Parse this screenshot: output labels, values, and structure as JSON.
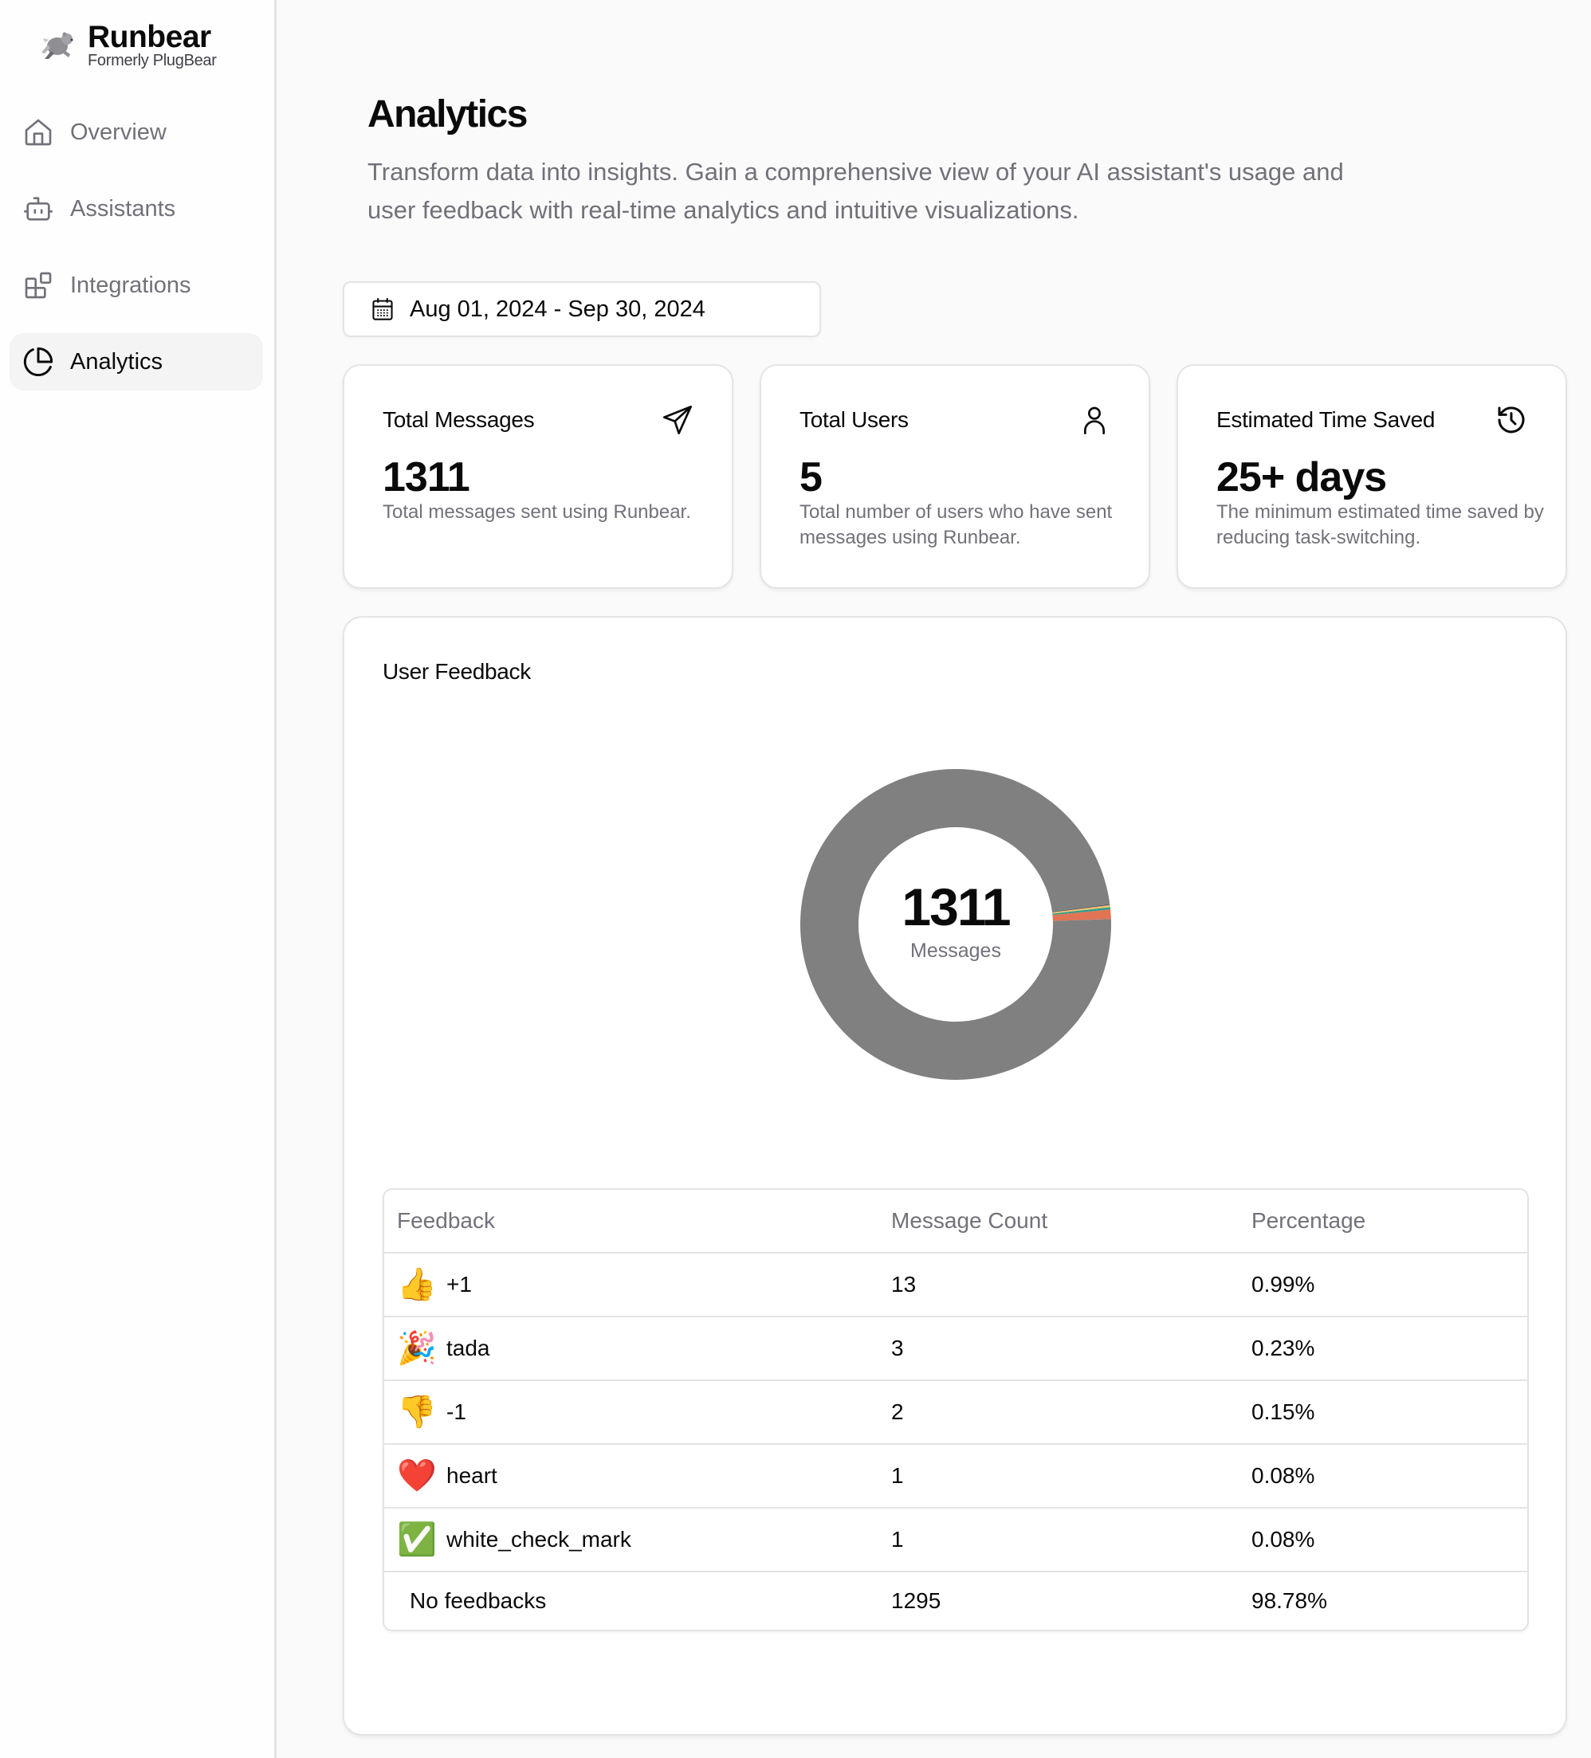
{
  "brand": {
    "name": "Runbear",
    "subtitle": "Formerly PlugBear",
    "logo_icon": "running-bear-logo"
  },
  "sidebar": {
    "items": [
      {
        "label": "Overview",
        "icon": "home-icon",
        "active": false
      },
      {
        "label": "Assistants",
        "icon": "bot-icon",
        "active": false
      },
      {
        "label": "Integrations",
        "icon": "blocks-icon",
        "active": false
      },
      {
        "label": "Analytics",
        "icon": "pie-chart-icon",
        "active": true
      }
    ]
  },
  "header": {
    "title": "Analytics",
    "description": "Transform data into insights. Gain a comprehensive view of your AI assistant's usage and user feedback with real-time analytics and intuitive visualizations."
  },
  "date_range": {
    "label": "Aug 01, 2024 - Sep 30, 2024",
    "icon": "calendar-icon"
  },
  "stats": [
    {
      "label": "Total Messages",
      "value": "1311",
      "description": "Total messages sent using Runbear.",
      "icon": "send-icon"
    },
    {
      "label": "Total Users",
      "value": "5",
      "description": "Total number of users who have sent messages using Runbear.",
      "icon": "user-icon"
    },
    {
      "label": "Estimated Time Saved",
      "value": "25+ days",
      "description": "The minimum estimated time saved by reducing task-switching.",
      "icon": "history-icon"
    }
  ],
  "feedback": {
    "title": "User Feedback",
    "center_value": "1311",
    "center_label": "Messages",
    "columns": [
      "Feedback",
      "Message Count",
      "Percentage"
    ],
    "rows": [
      {
        "emoji": "👍",
        "name": "+1",
        "count": "13",
        "percentage": "0.99%"
      },
      {
        "emoji": "🎉",
        "name": "tada",
        "count": "3",
        "percentage": "0.23%"
      },
      {
        "emoji": "👎",
        "name": "-1",
        "count": "2",
        "percentage": "0.15%"
      },
      {
        "emoji": "❤️",
        "name": "heart",
        "count": "1",
        "percentage": "0.08%"
      },
      {
        "emoji": "✅",
        "name": "white_check_mark",
        "count": "1",
        "percentage": "0.08%"
      },
      {
        "emoji": "",
        "name": "No feedbacks",
        "count": "1295",
        "percentage": "98.78%"
      }
    ]
  },
  "chart_data": {
    "type": "pie",
    "variant": "donut",
    "title": "User Feedback",
    "center_text": "1311 Messages",
    "categories": [
      "+1",
      "tada",
      "-1",
      "heart",
      "white_check_mark",
      "No feedbacks"
    ],
    "values": [
      13,
      3,
      2,
      1,
      1,
      1295
    ],
    "colors": [
      "#e07455",
      "#2a9d8f",
      "#e9c46a",
      "#f4a261",
      "#264653",
      "#808080"
    ]
  }
}
